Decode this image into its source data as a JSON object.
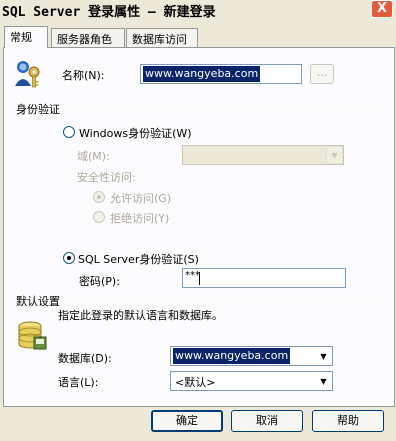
{
  "window": {
    "title": "SQL Server 登录属性 — 新建登录",
    "close_glyph": "X"
  },
  "tabs": [
    "常规",
    "服务器角色",
    "数据库访问"
  ],
  "general": {
    "name_label": "名称(N):",
    "name_value": "www.wangyeba.com",
    "browse_label": "...",
    "auth_section": "身份验证",
    "windows_auth_label": "Windows身份验证(W)",
    "domain_label": "域(M):",
    "security_access_label": "安全性访问:",
    "allow_access_label": "允许访问(G)",
    "deny_access_label": "拒绝访问(Y)",
    "sql_auth_label": "SQL Server身份验证(S)",
    "password_label": "密码(P):",
    "password_value": "***",
    "defaults_section": "默认设置",
    "defaults_desc": "指定此登录的默认语言和数据库。",
    "database_label": "数据库(D):",
    "database_value": "www.wangyeba.com",
    "language_label": "语言(L):",
    "language_value": "<默认>"
  },
  "buttons": {
    "ok": "确定",
    "cancel": "取消",
    "help": "帮助"
  }
}
